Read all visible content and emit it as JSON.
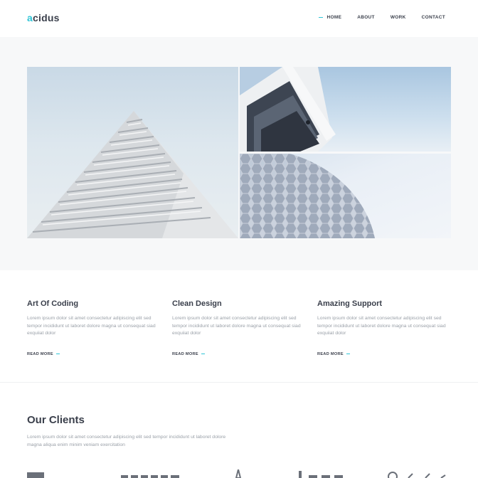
{
  "header": {
    "logo_accent": "a",
    "logo_rest": "cidus",
    "nav": [
      {
        "label": "HOME",
        "active": true
      },
      {
        "label": "ABOUT",
        "active": false
      },
      {
        "label": "WORK",
        "active": false
      },
      {
        "label": "CONTACT",
        "active": false
      }
    ]
  },
  "hero": {
    "images": [
      "building-pyramid-photo",
      "building-balconies-photo",
      "hexagon-dome-photo"
    ]
  },
  "features": [
    {
      "title": "Art Of Coding",
      "text": "Lorem ipsum dolor sit amet consectetur adipiscing elit sed tempor incididunt ut laboret dolore magna ut consequat siad exquiiat dolor",
      "link": "READ MORE"
    },
    {
      "title": "Clean Design",
      "text": "Lorem ipsum dolor sit amet consectetur adipiscing elit sed tempor incididunt ut laboret dolore magna ut consequat siad exquiiat dolor",
      "link": "READ MORE"
    },
    {
      "title": "Amazing Support",
      "text": "Lorem ipsum dolor sit amet consectetur adipiscing elit sed tempor incididunt ut laboret dolore magna ut consequat siad exquiiat dolor",
      "link": "READ MORE"
    }
  ],
  "clients": {
    "title": "Our Clients",
    "text": "Lorem ipsum dolor sit amet consectetur adipiscing elit sed tempor incididunt ut laboret dolore magna aliqua enim minim veniam exercitation"
  },
  "colors": {
    "accent": "#2ec4d6",
    "text_dark": "#3a3f4b",
    "text_muted": "#9aa0a8",
    "hero_bg": "#f7f8f9"
  }
}
